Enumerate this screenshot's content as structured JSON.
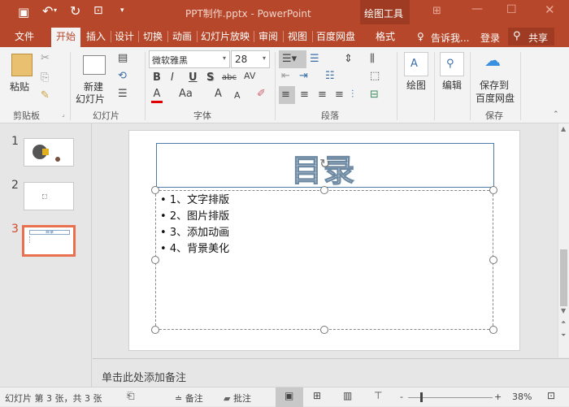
{
  "titlebar": {
    "doc_title": "PPT制作.pptx - PowerPoint",
    "context_tool": "绘图工具"
  },
  "tabs": [
    "文件",
    "开始",
    "插入",
    "设计",
    "切换",
    "动画",
    "幻灯片放映",
    "审阅",
    "视图",
    "百度网盘",
    "格式"
  ],
  "tell_me": "告诉我...",
  "login": "登录",
  "share": "共享",
  "ribbon": {
    "clipboard": {
      "paste": "粘贴",
      "label": "剪贴板"
    },
    "slides": {
      "new_slide_1": "新建",
      "new_slide_2": "幻灯片",
      "label": "幻灯片"
    },
    "font": {
      "font_name": "微软雅黑",
      "font_size": "28",
      "bold": "B",
      "italic": "I",
      "underline": "U",
      "shadow": "S",
      "strike": "abc",
      "spacing": "AV",
      "color": "A",
      "case": "Aa",
      "grow": "A",
      "shrink": "A",
      "label": "字体"
    },
    "paragraph": {
      "label": "段落"
    },
    "drawing": {
      "label": "绘图"
    },
    "editing": {
      "label": "编辑"
    },
    "save": {
      "line1": "保存到",
      "line2": "百度网盘",
      "label": "保存"
    }
  },
  "thumbnails": [
    {
      "num": "1"
    },
    {
      "num": "2"
    },
    {
      "num": "3",
      "title": "目录"
    }
  ],
  "slide": {
    "title": "目录",
    "bullets": [
      "1、文字排版",
      "2、图片排版",
      "3、添加动画",
      "4、背景美化"
    ]
  },
  "notes_placeholder": "单击此处添加备注",
  "status": {
    "slide_info": "幻灯片 第 3 张，共 3 张",
    "notes": "备注",
    "comments": "批注",
    "zoom": "38%",
    "zoom_percent": 38
  },
  "colors": {
    "accent": "#b7472a",
    "selected_thumb": "#e8704f"
  }
}
